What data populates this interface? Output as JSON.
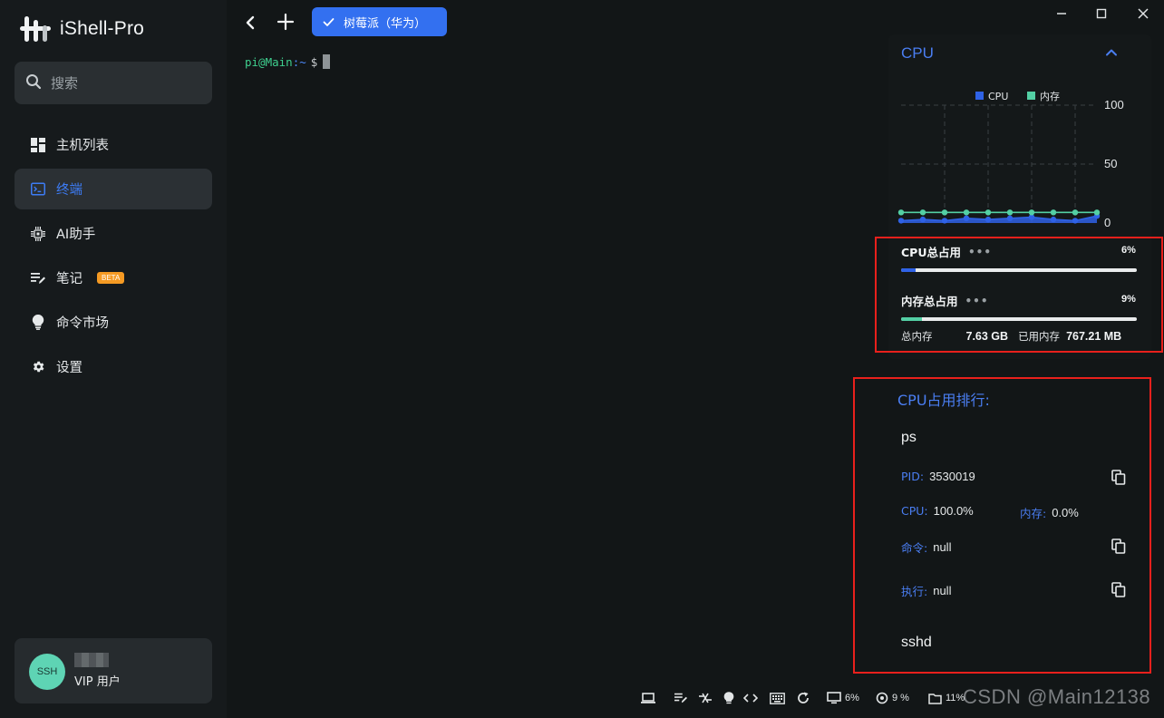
{
  "app": {
    "name": "iShell-Pro"
  },
  "search": {
    "placeholder": "搜索"
  },
  "sidebar": {
    "items": [
      {
        "label": "主机列表",
        "icon": "dashboard-icon"
      },
      {
        "label": "终端",
        "icon": "terminal-icon",
        "active": true
      },
      {
        "label": "AI助手",
        "icon": "ai-chip-icon"
      },
      {
        "label": "笔记",
        "icon": "notes-icon",
        "badge": "BETA"
      },
      {
        "label": "命令市场",
        "icon": "lightbulb-icon"
      },
      {
        "label": "设置",
        "icon": "gear-icon"
      }
    ]
  },
  "user": {
    "avatar_text": "SSH",
    "role": "VIP 用户"
  },
  "tabs": [
    {
      "label": "树莓派（华为）",
      "active": true
    }
  ],
  "terminal": {
    "user": "pi@Main",
    "path": ":~",
    "prompt": "$"
  },
  "cpu_panel": {
    "title": "CPU",
    "legend_cpu": "CPU",
    "legend_mem": "内存",
    "cpu_total_label": "CPU总占用",
    "cpu_total_pct": "6%",
    "mem_total_label": "内存总占用",
    "mem_total_pct": "9%",
    "cpu_fraction": 0.06,
    "mem_fraction": 0.09,
    "total_mem_label": "总内存",
    "total_mem_value": "7.63 GB",
    "used_mem_label": "已用内存",
    "used_mem_value": "767.21 MB"
  },
  "chart_data": {
    "type": "line",
    "x": [
      1,
      2,
      3,
      4,
      5,
      6,
      7,
      8,
      9,
      10
    ],
    "series": [
      {
        "name": "CPU",
        "values": [
          2,
          3,
          2,
          4,
          3,
          4,
          5,
          3,
          2,
          6
        ]
      },
      {
        "name": "内存",
        "values": [
          9,
          9,
          9,
          9,
          9,
          9,
          9,
          9,
          9,
          9
        ]
      }
    ],
    "yticks": [
      "100",
      "50",
      "0"
    ],
    "ylim": [
      0,
      100
    ],
    "grid": true,
    "legend": "top",
    "colors": {
      "cpu": "#2f62e6",
      "mem": "#53cfa4"
    }
  },
  "ranking": {
    "title": "CPU占用排行:",
    "processes": [
      {
        "name": "ps",
        "pid_label": "PID:",
        "pid": "3530019",
        "cpu_label": "CPU:",
        "cpu": "100.0%",
        "mem_label": "内存:",
        "mem": "0.0%",
        "cmd_label": "命令:",
        "cmd": "null",
        "exec_label": "执行:",
        "exec": "null"
      },
      {
        "name": "sshd"
      }
    ]
  },
  "statusbar": {
    "cpu_pct": "6%",
    "mem_pct": "9 %",
    "disk_pct": "11%"
  },
  "watermark": "CSDN @Main12138"
}
